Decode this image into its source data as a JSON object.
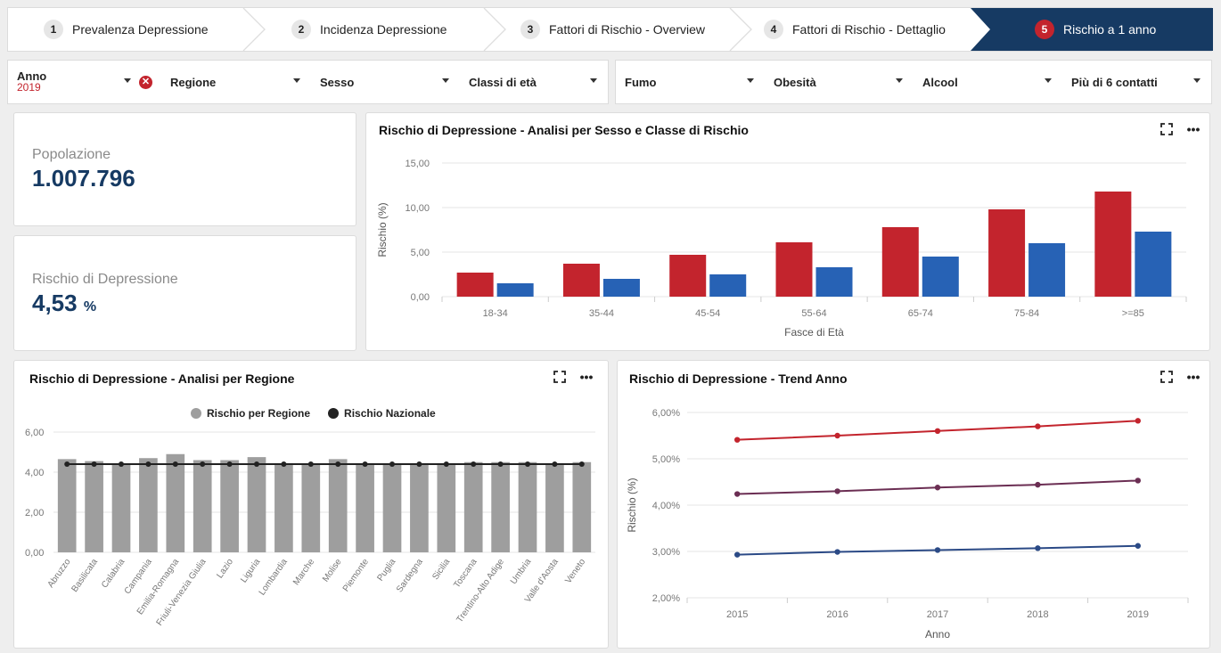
{
  "steps": [
    {
      "num": "1",
      "label": "Prevalenza Depressione"
    },
    {
      "num": "2",
      "label": "Incidenza Depressione"
    },
    {
      "num": "3",
      "label": "Fattori di Rischio - Overview"
    },
    {
      "num": "4",
      "label": "Fattori di Rischio - Dettaglio"
    },
    {
      "num": "5",
      "label": "Rischio a 1 anno"
    }
  ],
  "filters": {
    "anno_label": "Anno",
    "anno_value": "2019",
    "regione": "Regione",
    "sesso": "Sesso",
    "classi_eta": "Classi di età",
    "fumo": "Fumo",
    "obesita": "Obesità",
    "alcool": "Alcool",
    "contatti": "Più di 6 contatti"
  },
  "kpi": {
    "popolazione_label": "Popolazione",
    "popolazione_value": "1.007.796",
    "rischio_label": "Rischio di Depressione",
    "rischio_value": "4,53",
    "rischio_unit": "%"
  },
  "colors": {
    "red": "#c3242d",
    "blue": "#2762b5",
    "navy": "#163a63",
    "grey_bar": "#9e9e9e",
    "purple": "#6b2e53",
    "line_blue": "#2b4a86"
  },
  "chart_sesso": {
    "title": "Rischio di Depressione - Analisi per Sesso e Classe di Rischio",
    "chart_data": {
      "type": "bar",
      "categories": [
        "18-34",
        "35-44",
        "45-54",
        "55-64",
        "65-74",
        "75-84",
        ">=85"
      ],
      "series": [
        {
          "values": [
            2.7,
            3.7,
            4.7,
            6.1,
            7.8,
            9.8,
            11.8
          ]
        },
        {
          "values": [
            1.5,
            2.0,
            2.5,
            3.3,
            4.5,
            6.0,
            7.3
          ]
        }
      ],
      "xlabel": "Fasce di Età",
      "ylabel": "Rischio (%)",
      "ylim": [
        0,
        15
      ],
      "yticks": [
        "0,00",
        "5,00",
        "10,00",
        "15,00"
      ]
    }
  },
  "chart_regione": {
    "title": "Rischio di Depressione - Analisi per Regione",
    "chart_data": {
      "type": "bar",
      "categories": [
        "Abruzzo",
        "Basilicata",
        "Calabria",
        "Campania",
        "Emilia-Romagna",
        "Friuli-Venezia Giulia",
        "Lazio",
        "Liguria",
        "Lombardia",
        "Marche",
        "Molise",
        "Piemonte",
        "Puglia",
        "Sardegna",
        "Sicilia",
        "Toscana",
        "Trentino-Alto Adige",
        "Umbria",
        "Valle d'Aosta",
        "Veneto"
      ],
      "series": [
        {
          "name": "Rischio per Regione",
          "values": [
            4.65,
            4.55,
            4.4,
            4.7,
            4.9,
            4.6,
            4.6,
            4.75,
            4.45,
            4.4,
            4.65,
            4.45,
            4.4,
            4.45,
            4.45,
            4.5,
            4.5,
            4.5,
            4.45,
            4.5
          ]
        },
        {
          "name": "Rischio Nazionale",
          "values": [
            4.4,
            4.4,
            4.4,
            4.4,
            4.4,
            4.4,
            4.4,
            4.4,
            4.4,
            4.4,
            4.4,
            4.4,
            4.4,
            4.4,
            4.4,
            4.4,
            4.4,
            4.4,
            4.4,
            4.4
          ]
        }
      ],
      "ylim": [
        0,
        6
      ],
      "yticks": [
        "0,00",
        "2,00",
        "4,00",
        "6,00"
      ],
      "legend": "top-center"
    }
  },
  "chart_trend": {
    "title": "Rischio di Depressione - Trend Anno",
    "chart_data": {
      "type": "line",
      "x": [
        "2015",
        "2016",
        "2017",
        "2018",
        "2019"
      ],
      "series": [
        {
          "values": [
            5.41,
            5.5,
            5.6,
            5.7,
            5.82
          ]
        },
        {
          "values": [
            4.24,
            4.3,
            4.38,
            4.44,
            4.53
          ]
        },
        {
          "values": [
            2.93,
            2.99,
            3.03,
            3.07,
            3.12
          ]
        }
      ],
      "xlabel": "Anno",
      "ylabel": "Rischio (%)",
      "ylim": [
        2,
        6
      ],
      "yticks": [
        "2,00%",
        "3,00%",
        "4,00%",
        "5,00%",
        "6,00%"
      ]
    }
  }
}
